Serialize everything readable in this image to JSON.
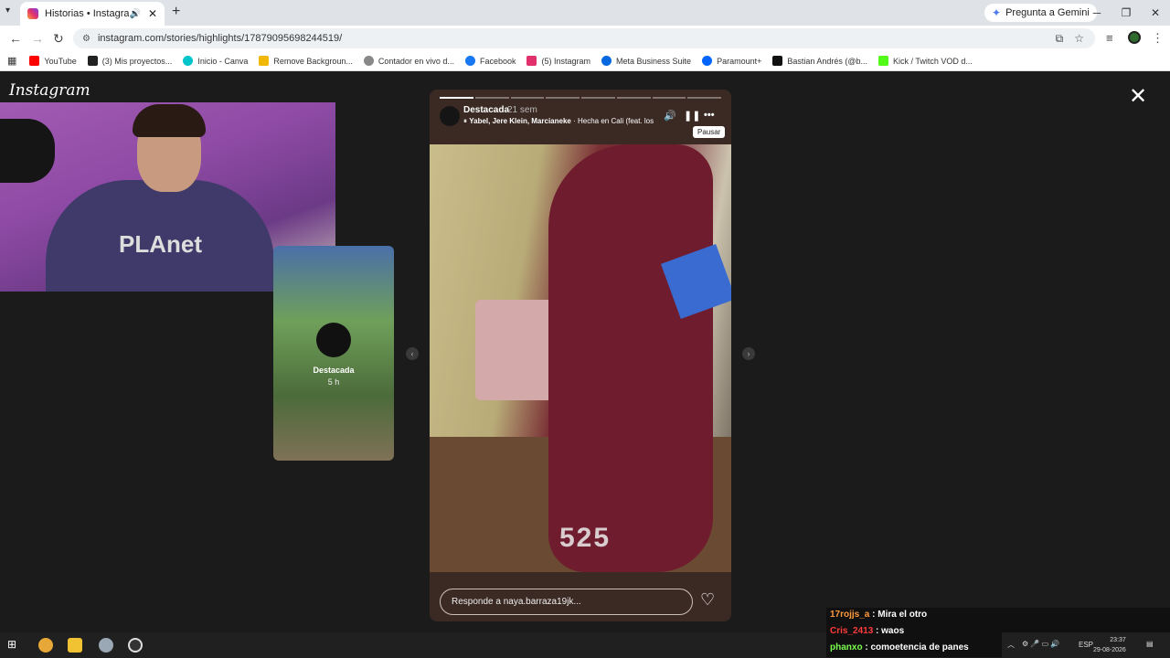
{
  "browser": {
    "tab_title": "Historias • Instagram",
    "gemini_label": "Pregunta a Gemini",
    "url": "instagram.com/stories/highlights/17879095698244519/"
  },
  "bookmarks": [
    {
      "label": "YouTube",
      "color": "#ff0000"
    },
    {
      "label": "(3) Mis proyectos...",
      "color": "#222222"
    },
    {
      "label": "Inicio - Canva",
      "color": "#00c4cc"
    },
    {
      "label": "Remove Backgroun...",
      "color": "#f2b807"
    },
    {
      "label": "Contador en vivo d...",
      "color": "#888888"
    },
    {
      "label": "Facebook",
      "color": "#1877f2"
    },
    {
      "label": "(5) Instagram",
      "color": "#e1306c"
    },
    {
      "label": "Meta Business Suite",
      "color": "#0668e1"
    },
    {
      "label": "Paramount+",
      "color": "#0064ff"
    },
    {
      "label": "Bastian Andrés (@b...",
      "color": "#111111"
    },
    {
      "label": "Kick / Twitch VOD d...",
      "color": "#53fc18"
    }
  ],
  "page": {
    "logo": "Instagram",
    "preview": {
      "name": "Destacada",
      "time": "5 h"
    },
    "story": {
      "username": "Destacada",
      "time": "21 sem",
      "music_prefix": "Yabel, Jere Klein, Marcianeke",
      "music_song": " · Hecha en Cali (feat. los b",
      "pause_tooltip": "Pausar",
      "sticker_text": "525",
      "reply_placeholder": "Responde a naya.barraza19jk...",
      "segments_total": 8,
      "segments_done": 1
    }
  },
  "chat": [
    {
      "user": "17rojjs_a",
      "message": " : Mira el otro",
      "color": "#ff9a3c"
    },
    {
      "user": "Cris_2413",
      "message": " : waos",
      "color": "#ff3b3b"
    },
    {
      "user": "phanxo",
      "message": " : comoetencia de panes",
      "color": "#7cff4d"
    }
  ],
  "tray": {
    "lang": "ESP",
    "time": "23:37",
    "date": "29-08-2026"
  }
}
